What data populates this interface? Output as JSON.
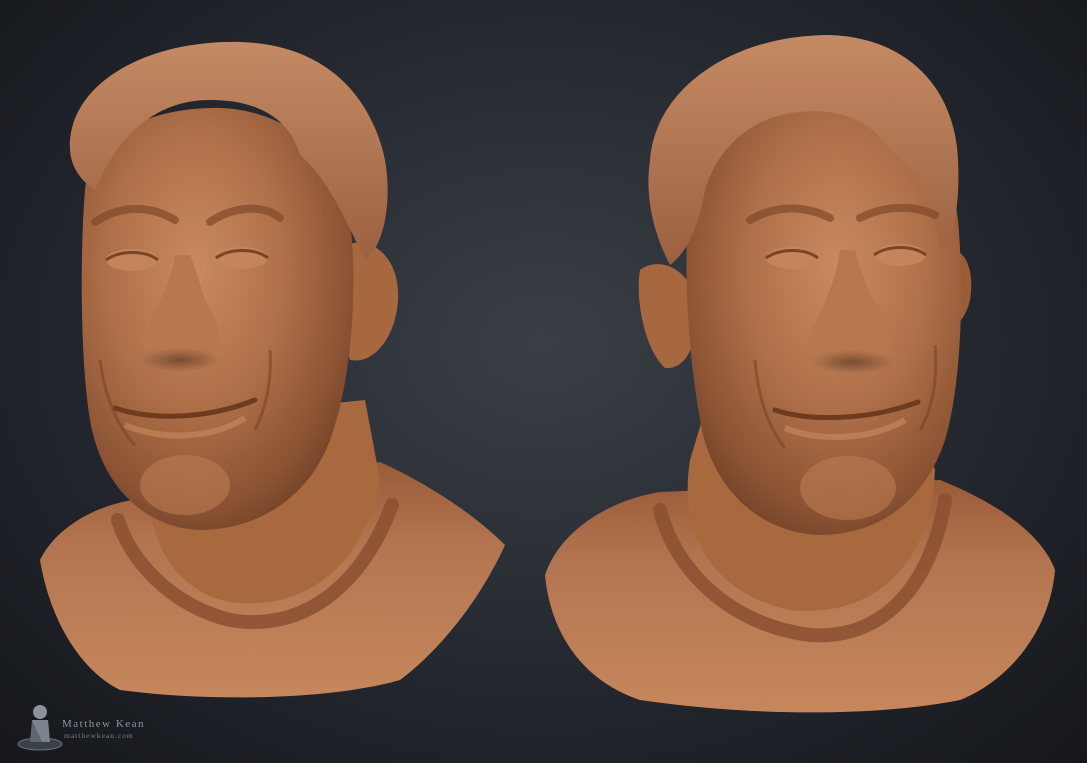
{
  "scene": {
    "background_color": "#1d2026",
    "clay_color": "#b0714a"
  },
  "watermark": {
    "name": "Matthew Kean",
    "site": "matthewkean.com",
    "icon": "pawn-logo-icon"
  }
}
